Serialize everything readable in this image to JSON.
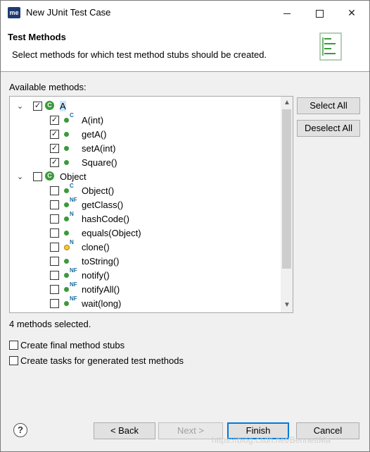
{
  "window": {
    "title": "New JUnit Test Case",
    "app_icon": "me"
  },
  "header": {
    "title": "Test Methods",
    "description": "Select methods for which test method stubs should be created."
  },
  "methods_label": "Available methods:",
  "tree": [
    {
      "kind": "class",
      "label": "A",
      "checked": true,
      "expanded": true,
      "icon": "class-icon"
    },
    {
      "kind": "method",
      "label": "A(int)",
      "checked": true,
      "modifier": "C"
    },
    {
      "kind": "method",
      "label": "getA()",
      "checked": true,
      "modifier": ""
    },
    {
      "kind": "method",
      "label": "setA(int)",
      "checked": true,
      "modifier": ""
    },
    {
      "kind": "method",
      "label": "Square()",
      "checked": true,
      "modifier": ""
    },
    {
      "kind": "class",
      "label": "Object",
      "checked": false,
      "expanded": true,
      "icon": "class-icon"
    },
    {
      "kind": "method",
      "label": "Object()",
      "checked": false,
      "modifier": "C"
    },
    {
      "kind": "method",
      "label": "getClass()",
      "checked": false,
      "modifier": "NF"
    },
    {
      "kind": "method",
      "label": "hashCode()",
      "checked": false,
      "modifier": "N"
    },
    {
      "kind": "method",
      "label": "equals(Object)",
      "checked": false,
      "modifier": ""
    },
    {
      "kind": "method",
      "label": "clone()",
      "checked": false,
      "modifier": "N",
      "protected": true
    },
    {
      "kind": "method",
      "label": "toString()",
      "checked": false,
      "modifier": ""
    },
    {
      "kind": "method",
      "label": "notify()",
      "checked": false,
      "modifier": "NF"
    },
    {
      "kind": "method",
      "label": "notifyAll()",
      "checked": false,
      "modifier": "NF"
    },
    {
      "kind": "method",
      "label": "wait(long)",
      "checked": false,
      "modifier": "NF"
    }
  ],
  "side_buttons": {
    "select_all": "Select All",
    "deselect_all": "Deselect All"
  },
  "status": "4 methods selected.",
  "options": {
    "final_stubs": "Create final method stubs",
    "create_tasks": "Create tasks for generated test methods"
  },
  "footer": {
    "back": "< Back",
    "next": "Next >",
    "finish": "Finish",
    "cancel": "Cancel",
    "help": "?"
  },
  "watermark": "https://blog.csdn.net/BennettMa"
}
